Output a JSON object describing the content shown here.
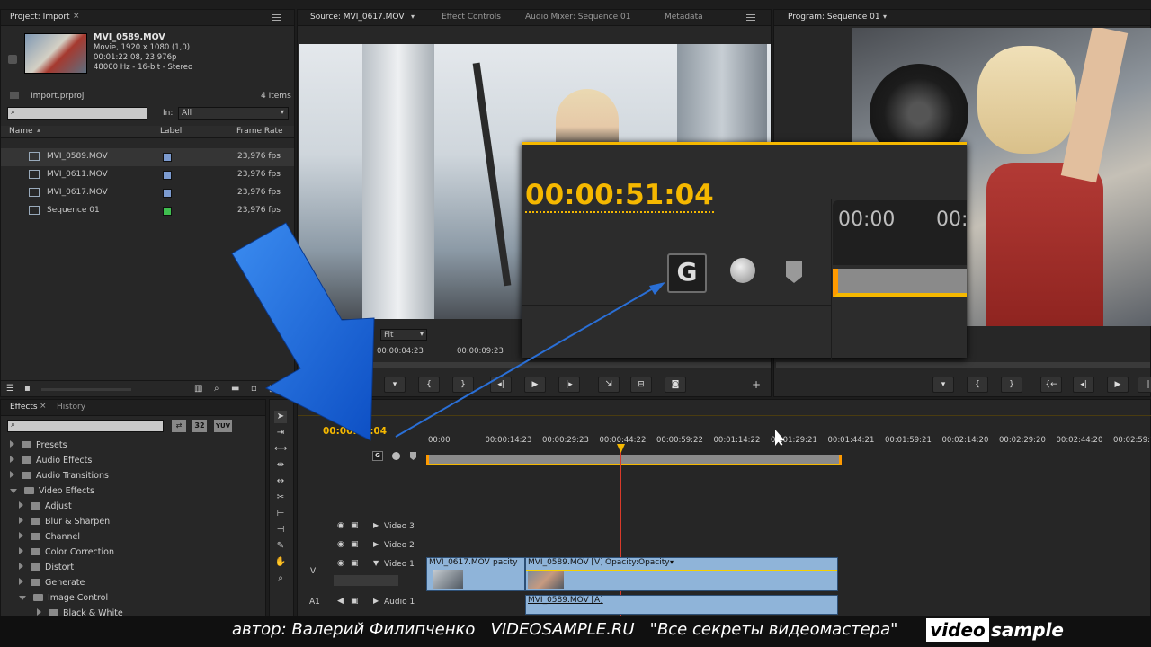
{
  "project": {
    "tab": "Project: Import",
    "clip_name": "MVI_0589.MOV",
    "clip_info": [
      "Movie, 1920 x 1080 (1,0)",
      "00:01:22:08, 23,976p",
      "48000 Hz - 16-bit - Stereo"
    ],
    "project_file": "Import.prproj",
    "items_count": "4 Items",
    "in_label": "In:",
    "in_value": "All",
    "columns": [
      "Name",
      "Label",
      "Frame Rate"
    ],
    "rows": [
      {
        "name": "MVI_0589.MOV",
        "color": "#7c9bd0",
        "rate": "23,976 fps"
      },
      {
        "name": "MVI_0611.MOV",
        "color": "#7c9bd0",
        "rate": "23,976 fps"
      },
      {
        "name": "MVI_0617.MOV",
        "color": "#7c9bd0",
        "rate": "23,976 fps"
      },
      {
        "name": "Sequence 01",
        "color": "#3fbf4f",
        "rate": "23,976 fps"
      }
    ]
  },
  "source": {
    "tabs": [
      "Source: MVI_0617.MOV",
      "Effect Controls",
      "Audio Mixer: Sequence 01",
      "Metadata"
    ],
    "fit": "Fit",
    "time_in": "00:00:04:23",
    "time_out": "00:00:09:23"
  },
  "program": {
    "tab": "Program: Sequence 01"
  },
  "zoom": {
    "timecode": "00:00:51:04",
    "ruler_a": "00:00",
    "ruler_b": "00:"
  },
  "effects": {
    "tabs": [
      "Effects",
      "History"
    ],
    "badge_32": "32",
    "badge_yuv": "YUV",
    "items": [
      {
        "label": "Presets",
        "level": 0,
        "open": false
      },
      {
        "label": "Audio Effects",
        "level": 0,
        "open": false
      },
      {
        "label": "Audio Transitions",
        "level": 0,
        "open": false
      },
      {
        "label": "Video Effects",
        "level": 0,
        "open": true
      },
      {
        "label": "Adjust",
        "level": 1,
        "open": false
      },
      {
        "label": "Blur & Sharpen",
        "level": 1,
        "open": false
      },
      {
        "label": "Channel",
        "level": 1,
        "open": false
      },
      {
        "label": "Color Correction",
        "level": 1,
        "open": false
      },
      {
        "label": "Distort",
        "level": 1,
        "open": false
      },
      {
        "label": "Generate",
        "level": 1,
        "open": false
      },
      {
        "label": "Image Control",
        "level": 1,
        "open": true
      },
      {
        "label": "Black & White",
        "level": 2,
        "open": false
      }
    ]
  },
  "timeline": {
    "timecode": "00:00:51:04",
    "ruler": [
      "00:00",
      "00:00:14:23",
      "00:00:29:23",
      "00:00:44:22",
      "00:00:59:22",
      "00:01:14:22",
      "00:01:29:21",
      "00:01:44:21",
      "00:01:59:21",
      "00:02:14:20",
      "00:02:29:20",
      "00:02:44:20",
      "00:02:59:19",
      "00:0"
    ],
    "tracks": [
      "Video 3",
      "Video 2",
      "Video 1",
      "Audio 1"
    ],
    "v_label": "V",
    "a_label": "A1",
    "clip1": "MVI_0617.MOV",
    "clip1_opacity": "pacity",
    "clip2": "MVI_0589.MOV [V]",
    "clip2_opacity": "Opacity:Opacity",
    "audio_clip": "MVI_0589.MOV [A]"
  },
  "caption": {
    "text": "автор: Валерий Филипченко   VIDEOSAMPLE.RU   \"Все секреты видеомастера\"",
    "logo_a": "video",
    "logo_b": "sample"
  },
  "colors": {
    "accent": "#f5b800",
    "clip_blue": "#8fb4d9",
    "arrow_blue": "#1f6fe0",
    "playhead": "#d83a2a"
  }
}
